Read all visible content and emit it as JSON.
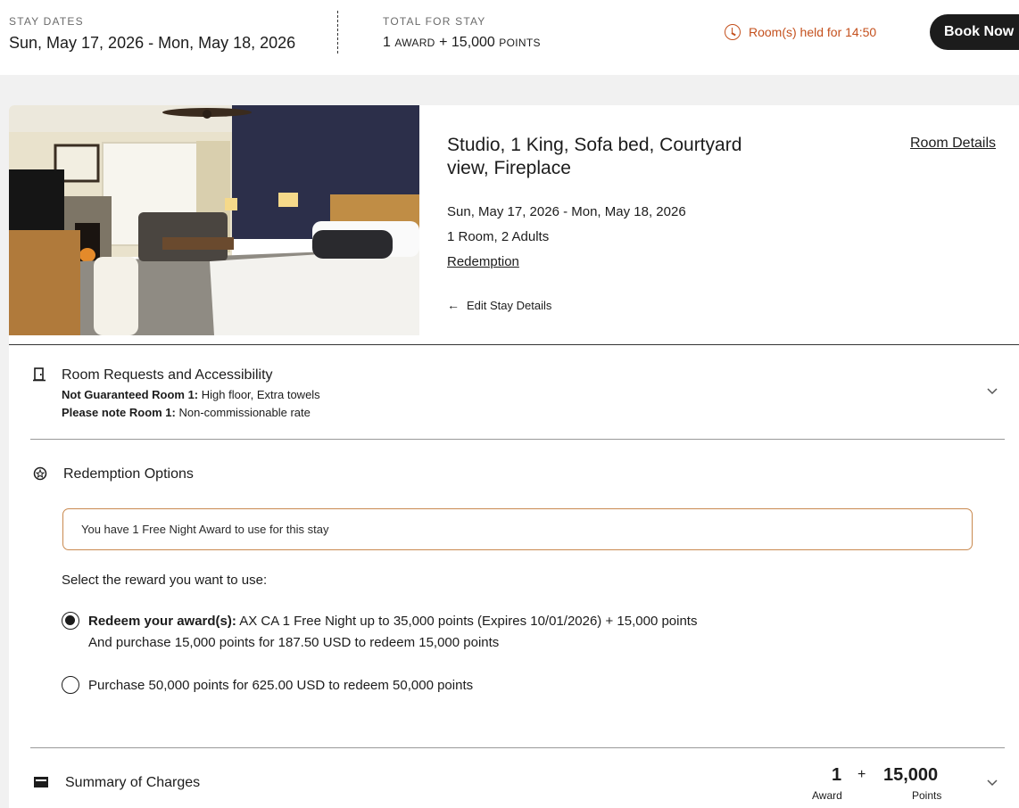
{
  "header": {
    "stay_dates_label": "STAY DATES",
    "stay_dates_value": "Sun, May 17, 2026 - Mon, May 18, 2026",
    "total_label": "TOTAL FOR STAY",
    "total_award_count": "1",
    "total_award_unit": "AWARD",
    "total_plus": "+",
    "total_points": "15,000",
    "total_points_unit": "POINTS",
    "hold_text": "Room(s) held for 14:50",
    "book_button": "Book Now"
  },
  "room": {
    "title": "Studio, 1 King, Sofa bed, Courtyard view, Fireplace",
    "details_link": "Room Details",
    "dates": "Sun, May 17, 2026 - Mon, May 18, 2026",
    "occupancy": "1 Room, 2 Adults",
    "rate_link": "Redemption",
    "edit_link": "Edit Stay Details",
    "photo_alt": "hotel room with king bed, sofa and fireplace"
  },
  "requests": {
    "title": "Room Requests and Accessibility",
    "line1_label": "Not Guaranteed Room 1:",
    "line1_value": " High floor, Extra towels",
    "line2_label": "Please note Room 1:",
    "line2_value": " Non-commissionable rate"
  },
  "redemption": {
    "title": "Redemption Options",
    "award_notice": "You have 1 Free Night Award  to use for this stay",
    "select_label": "Select the reward you want to use:",
    "option1_bold": "Redeem your award(s):",
    "option1_text": " AX CA 1 Free Night up to 35,000 points (Expires 10/01/2026) + 15,000 points",
    "option1_line2": "And purchase 15,000 points for 187.50 USD to redeem 15,000 points",
    "option1_selected": true,
    "option2_text": "Purchase 50,000 points for 625.00 USD to redeem 50,000 points",
    "option2_selected": false
  },
  "summary": {
    "title": "Summary of Charges",
    "award_value": "1",
    "plus": "+",
    "points_value": "15,000",
    "award_label": "Award",
    "points_label": "Points"
  },
  "colors": {
    "accent_orange": "#c4501d",
    "notice_border": "#c9894f",
    "dark": "#1c1c1c"
  }
}
